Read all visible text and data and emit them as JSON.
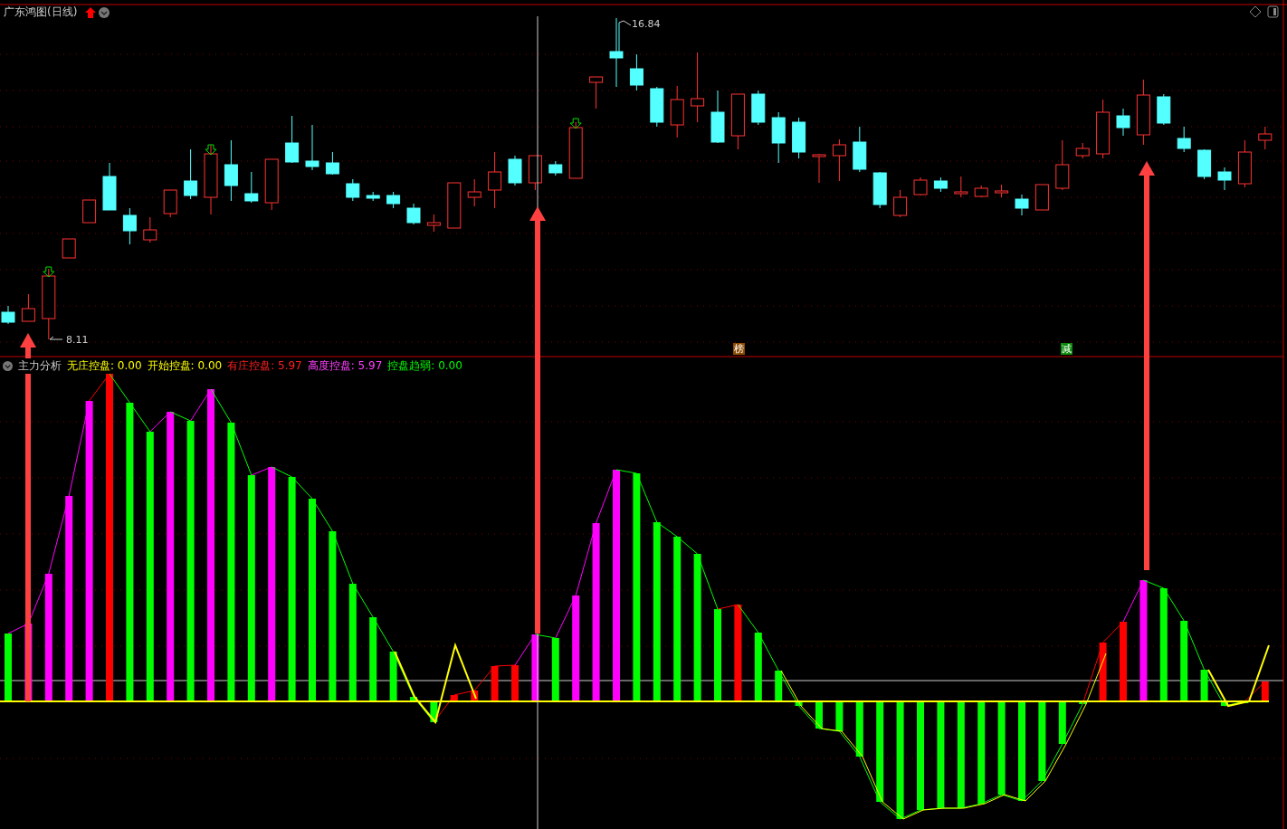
{
  "title": "广东鸿图(日线)",
  "price_markers": [
    {
      "kind": "high",
      "text": "16.84"
    },
    {
      "kind": "low",
      "text": "8.11"
    }
  ],
  "badges": [
    {
      "text": "榜",
      "color": "#8b4a00"
    },
    {
      "text": "减",
      "color": "#0a8a0a"
    }
  ],
  "indicator": {
    "name": "主力分析",
    "values": [
      {
        "label": "无庄控盘:",
        "value": "0.00",
        "color": "#ffff00"
      },
      {
        "label": "开始控盘:",
        "value": "0.00",
        "color": "#ffff00"
      },
      {
        "label": "有庄控盘:",
        "value": "5.97",
        "color": "#ff2020"
      },
      {
        "label": "高度控盘:",
        "value": "5.97",
        "color": "#ff40ff"
      },
      {
        "label": "控盘趋弱:",
        "value": "0.00",
        "color": "#00ff00"
      }
    ]
  }
}
